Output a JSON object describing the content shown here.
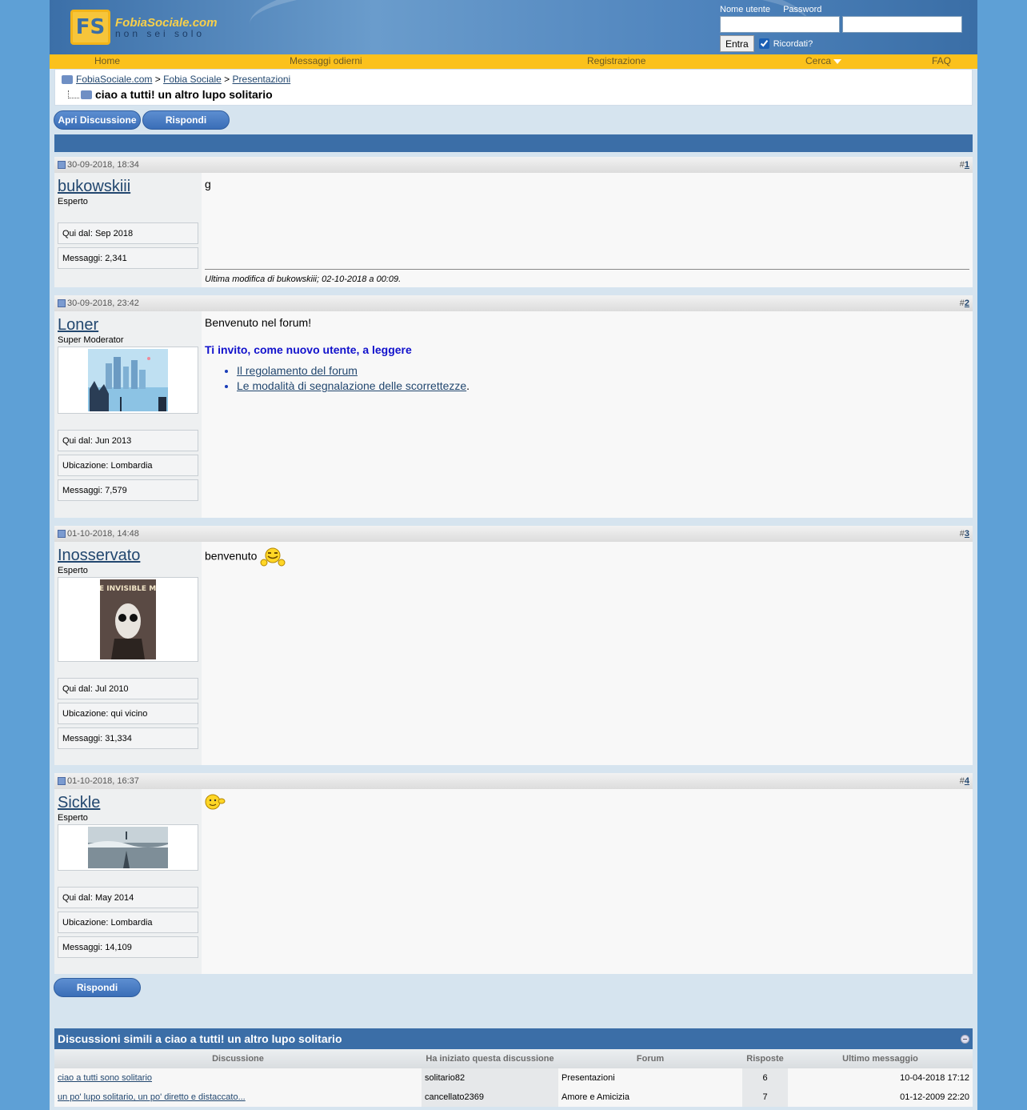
{
  "header": {
    "logo_mark": "FS",
    "logo_name": "FobiaSociale.com",
    "logo_tagline": "non sei solo",
    "login": {
      "username_label": "Nome utente",
      "password_label": "Password",
      "submit_label": "Entra",
      "remember_label": "Ricordati?",
      "remember_checked": true
    }
  },
  "navbar": {
    "items": [
      "Home",
      "Messaggi odierni",
      "Registrazione",
      "Cerca",
      "FAQ"
    ]
  },
  "breadcrumb": {
    "items": [
      "FobiaSociale.com",
      "Fobia Sociale",
      "Presentazioni"
    ],
    "separator": ">",
    "thread_title": "ciao a tutti! un altro lupo solitario"
  },
  "buttons": {
    "new_thread": "Apri Discussione",
    "reply": "Rispondi"
  },
  "posts": [
    {
      "date": "30-09-2018, 18:34",
      "number_prefix": "#",
      "number": "1",
      "username": "bukowskiii",
      "usertitle": "Esperto",
      "info": [
        "Qui dal: Sep 2018",
        "Messaggi: 2,341"
      ],
      "message": "g",
      "edit_note": "Ultima modifica di bukowskiii; 02-10-2018 a 00:09."
    },
    {
      "date": "30-09-2018, 23:42",
      "number_prefix": "#",
      "number": "2",
      "username": "Loner",
      "usertitle": "Super Moderator",
      "info": [
        "Qui dal: Jun 2013",
        "Ubicazione: Lombardia",
        "Messaggi: 7,579"
      ],
      "message": "Benvenuto nel forum!",
      "message_bold": "Ti invito, come nuovo utente, a leggere",
      "links": [
        "Il regolamento del forum",
        "Le modalità di segnalazione delle scorrettezze"
      ],
      "link_suffix": "."
    },
    {
      "date": "01-10-2018, 14:48",
      "number_prefix": "#",
      "number": "3",
      "username": "Inosservato",
      "usertitle": "Esperto",
      "info": [
        "Qui dal: Jul 2010",
        "Ubicazione: qui vicino",
        "Messaggi: 31,334"
      ],
      "message": "benvenuto",
      "avatar_text": "THE INVISIBLE MAN"
    },
    {
      "date": "01-10-2018, 16:37",
      "number_prefix": "#",
      "number": "4",
      "username": "Sickle",
      "usertitle": "Esperto",
      "info": [
        "Qui dal: May 2014",
        "Ubicazione: Lombardia",
        "Messaggi: 14,109"
      ]
    }
  ],
  "similar": {
    "title": "Discussioni simili a ciao a tutti! un altro lupo solitario",
    "columns": [
      "Discussione",
      "Ha iniziato questa discussione",
      "Forum",
      "Risposte",
      "Ultimo messaggio"
    ],
    "rows": [
      [
        "ciao a tutti sono solitario",
        "solitario82",
        "Presentazioni",
        "6",
        "10-04-2018 17:12"
      ],
      [
        "un po' lupo solitario, un po' diretto e distaccato...",
        "cancellato2369",
        "Amore e Amicizia",
        "7",
        "01-12-2009 22:20"
      ]
    ]
  },
  "colors": {
    "accent_blue": "#3b6ea7",
    "nav_yellow": "#fbc11c",
    "page_bg": "#5ea0d6"
  }
}
